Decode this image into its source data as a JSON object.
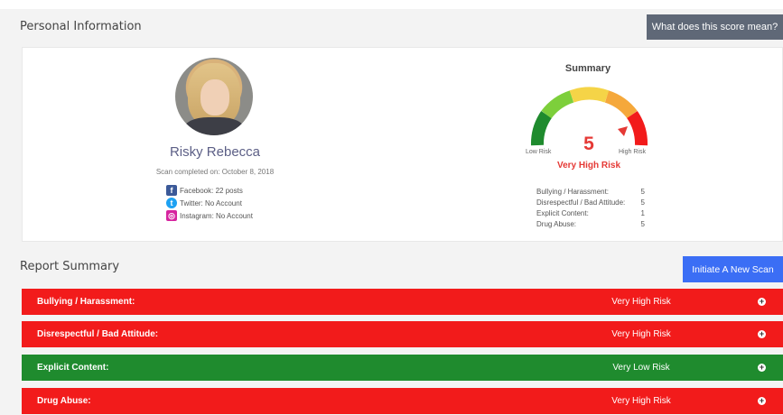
{
  "header": {
    "title": "Personal Information",
    "score_button": "What does this score mean?"
  },
  "profile": {
    "name": "Risky Rebecca",
    "scan_date": "Scan completed on: October 8, 2018",
    "socials": [
      {
        "icon": "facebook-icon",
        "text": "Facebook: 22 posts"
      },
      {
        "icon": "twitter-icon",
        "text": "Twitter: No Account"
      },
      {
        "icon": "instagram-icon",
        "text": "Instagram: No Account"
      }
    ]
  },
  "summary": {
    "title": "Summary",
    "low_label": "Low Risk",
    "high_label": "High Risk",
    "score": "5",
    "risk_text": "Very High Risk",
    "stats": [
      {
        "label": "Bullying / Harassment:",
        "value": "5"
      },
      {
        "label": "Disrespectful / Bad Attitude:",
        "value": "5"
      },
      {
        "label": "Explicit Content:",
        "value": "1"
      },
      {
        "label": "Drug Abuse:",
        "value": "5"
      }
    ]
  },
  "report": {
    "title": "Report Summary",
    "new_scan_button": "Initiate A New Scan",
    "rows": [
      {
        "category": "Bullying / Harassment:",
        "risk": "Very High Risk",
        "color": "#f21b1b"
      },
      {
        "category": "Disrespectful / Bad Attitude:",
        "risk": "Very High Risk",
        "color": "#f21b1b"
      },
      {
        "category": "Explicit Content:",
        "risk": "Very Low Risk",
        "color": "#1f8b2e"
      },
      {
        "category": "Drug Abuse:",
        "risk": "Very High Risk",
        "color": "#f21b1b"
      }
    ]
  },
  "colors": {
    "high_risk": "#e53935",
    "button_blue": "#3b6ef5",
    "button_grey": "#5f6877"
  }
}
